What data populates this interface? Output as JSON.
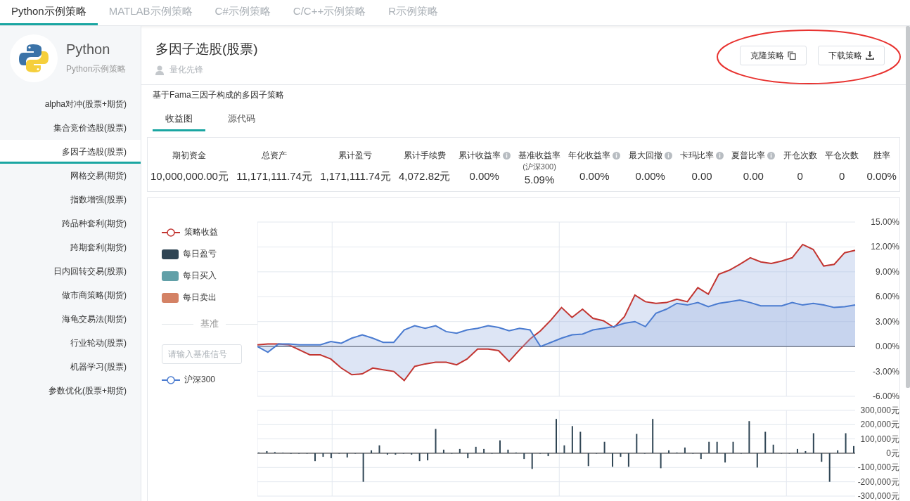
{
  "top_tabs": [
    {
      "label": "Python示例策略",
      "selected": true
    },
    {
      "label": "MATLAB示例策略",
      "selected": false
    },
    {
      "label": "C#示例策略",
      "selected": false
    },
    {
      "label": "C/C++示例策略",
      "selected": false
    },
    {
      "label": "R示例策略",
      "selected": false
    }
  ],
  "sidebar": {
    "title": "Python",
    "subtitle": "Python示例策略",
    "items": [
      {
        "label": "alpha对冲(股票+期货)",
        "selected": false
      },
      {
        "label": "集合竞价选股(股票)",
        "selected": false
      },
      {
        "label": "多因子选股(股票)",
        "selected": true
      },
      {
        "label": "网格交易(期货)",
        "selected": false
      },
      {
        "label": "指数增强(股票)",
        "selected": false
      },
      {
        "label": "跨品种套利(期货)",
        "selected": false
      },
      {
        "label": "跨期套利(期货)",
        "selected": false
      },
      {
        "label": "日内回转交易(股票)",
        "selected": false
      },
      {
        "label": "做市商策略(期货)",
        "selected": false
      },
      {
        "label": "海龟交易法(期货)",
        "selected": false
      },
      {
        "label": "行业轮动(股票)",
        "selected": false
      },
      {
        "label": "机器学习(股票)",
        "selected": false
      },
      {
        "label": "参数优化(股票+期货)",
        "selected": false
      }
    ]
  },
  "header": {
    "title": "多因子选股(股票)",
    "author": "量化先锋",
    "highlighted": true,
    "buttons": [
      {
        "label": "克隆策略",
        "kind": "clone"
      },
      {
        "label": "下载策略",
        "kind": "download"
      }
    ]
  },
  "description": "基于Fama三因子构成的多因子策略",
  "tabs": [
    {
      "label": "收益图",
      "selected": true
    },
    {
      "label": "源代码",
      "selected": false
    }
  ],
  "stats": [
    {
      "label": "期初资金",
      "value": "10,000,000.00元",
      "info": false
    },
    {
      "label": "总资产",
      "value": "11,171,111.74元",
      "info": false
    },
    {
      "label": "累计盈亏",
      "value": "1,171,111.74元",
      "info": false
    },
    {
      "label": "累计手续费",
      "value": "4,072.82元",
      "info": false
    },
    {
      "label": "累计收益率",
      "value": "0.00%",
      "info": true
    },
    {
      "label": "基准收益率",
      "sublabel": "(沪深300)",
      "value": "5.09%",
      "info": false
    },
    {
      "label": "年化收益率",
      "value": "0.00%",
      "info": true
    },
    {
      "label": "最大回撤",
      "value": "0.00%",
      "info": true
    },
    {
      "label": "卡玛比率",
      "value": "0.00",
      "info": true
    },
    {
      "label": "夏普比率",
      "value": "0.00",
      "info": true
    },
    {
      "label": "开仓次数",
      "value": "0",
      "info": false
    },
    {
      "label": "平仓次数",
      "value": "0",
      "info": false
    },
    {
      "label": "胜率",
      "value": "0.00%",
      "info": false
    }
  ],
  "chart": {
    "legend": [
      {
        "label": "策略收益",
        "kind": "line",
        "color": "#c23531"
      },
      {
        "label": "每日盈亏",
        "kind": "box",
        "color": "#2f4554"
      },
      {
        "label": "每日买入",
        "kind": "box",
        "color": "#61a0a8"
      },
      {
        "label": "每日卖出",
        "kind": "box",
        "color": "#d48265"
      }
    ],
    "benchmark_heading": "基准",
    "benchmark_placeholder": "请输入基准信号",
    "benchmark_legend": {
      "label": "沪深300",
      "kind": "line",
      "color": "#4a7bd0"
    },
    "returns": {
      "chart_data": {
        "type": "line",
        "grid": true,
        "ylim": [
          -6,
          15
        ],
        "yticks": [
          {
            "value": 15,
            "label": "15.00%"
          },
          {
            "value": 12,
            "label": "12.00%"
          },
          {
            "value": 9,
            "label": "9.00%"
          },
          {
            "value": 6,
            "label": "6.00%"
          },
          {
            "value": 3,
            "label": "3.00%"
          },
          {
            "value": 0,
            "label": "0.00%"
          },
          {
            "value": -3,
            "label": "-3.00%"
          },
          {
            "value": -6,
            "label": "-6.00%"
          }
        ],
        "series": [
          {
            "color": "#c23531",
            "values": [
              0.2,
              0.3,
              0.3,
              0.2,
              -0.4,
              -1.0,
              -1.0,
              -1.5,
              -2.6,
              -3.4,
              -3.3,
              -2.6,
              -2.8,
              -3.0,
              -4.1,
              -2.4,
              -2.1,
              -1.9,
              -1.9,
              -2.2,
              -1.5,
              -0.3,
              -0.3,
              -0.5,
              -1.8,
              -0.4,
              0.9,
              1.9,
              3.2,
              4.7,
              3.5,
              4.5,
              3.4,
              3.1,
              2.3,
              3.6,
              6.2,
              5.4,
              5.2,
              5.3,
              5.7,
              5.4,
              7.1,
              6.3,
              8.7,
              9.2,
              9.9,
              10.7,
              10.2,
              10.0,
              10.3,
              10.7,
              12.3,
              11.7,
              9.7,
              9.9,
              11.3,
              11.6
            ]
          },
          {
            "color": "#4a7bd0",
            "values": [
              0,
              -0.7,
              0.3,
              0.3,
              0.2,
              0.2,
              0.2,
              0.6,
              0.4,
              1.0,
              1.4,
              1.0,
              0.5,
              0.5,
              2.0,
              2.5,
              2.2,
              2.5,
              1.8,
              1.6,
              2.0,
              2.2,
              2.5,
              2.3,
              1.9,
              2.2,
              2.0,
              0.0,
              0.5,
              1.0,
              1.4,
              1.5,
              2.0,
              2.2,
              2.4,
              2.8,
              3.0,
              2.4,
              4.0,
              4.5,
              5.2,
              5.0,
              5.3,
              4.8,
              5.2,
              5.4,
              5.6,
              5.3,
              4.9,
              4.9,
              4.9,
              5.3,
              5.0,
              5.2,
              5.0,
              4.7,
              4.8,
              5.0
            ]
          }
        ]
      }
    },
    "pnl": {
      "chart_data": {
        "type": "bar",
        "grid": true,
        "ylim": [
          -300000,
          300000
        ],
        "yticks": [
          {
            "value": 300000,
            "label": "300,000元"
          },
          {
            "value": 200000,
            "label": "200,000元"
          },
          {
            "value": 100000,
            "label": "100,000元"
          },
          {
            "value": 0,
            "label": "0元"
          },
          {
            "value": -100000,
            "label": "-100,000元"
          },
          {
            "value": -200000,
            "label": "-200,000元"
          },
          {
            "value": -300000,
            "label": "-300,000元"
          }
        ],
        "series": [
          {
            "color": "#2f4554",
            "values": [
              5000,
              15000,
              8000,
              3000,
              -3000,
              0,
              0,
              -55000,
              -25000,
              -35000,
              0,
              -30000,
              0,
              -200000,
              20000,
              55000,
              -10000,
              -10000,
              0,
              -10000,
              -55000,
              -50000,
              170000,
              25000,
              0,
              30000,
              -35000,
              45000,
              30000,
              0,
              90000,
              25000,
              5000,
              -40000,
              -110000,
              0,
              -20000,
              240000,
              55000,
              190000,
              150000,
              -90000,
              0,
              80000,
              -95000,
              -25000,
              -95000,
              135000,
              0,
              240000,
              -105000,
              20000,
              5000,
              40000,
              0,
              -40000,
              80000,
              80000,
              -65000,
              80000,
              0,
              225000,
              -100000,
              150000,
              60000,
              0,
              0,
              30000,
              15000,
              140000,
              -60000,
              -200000,
              20000,
              140000,
              50000
            ]
          }
        ]
      }
    }
  }
}
